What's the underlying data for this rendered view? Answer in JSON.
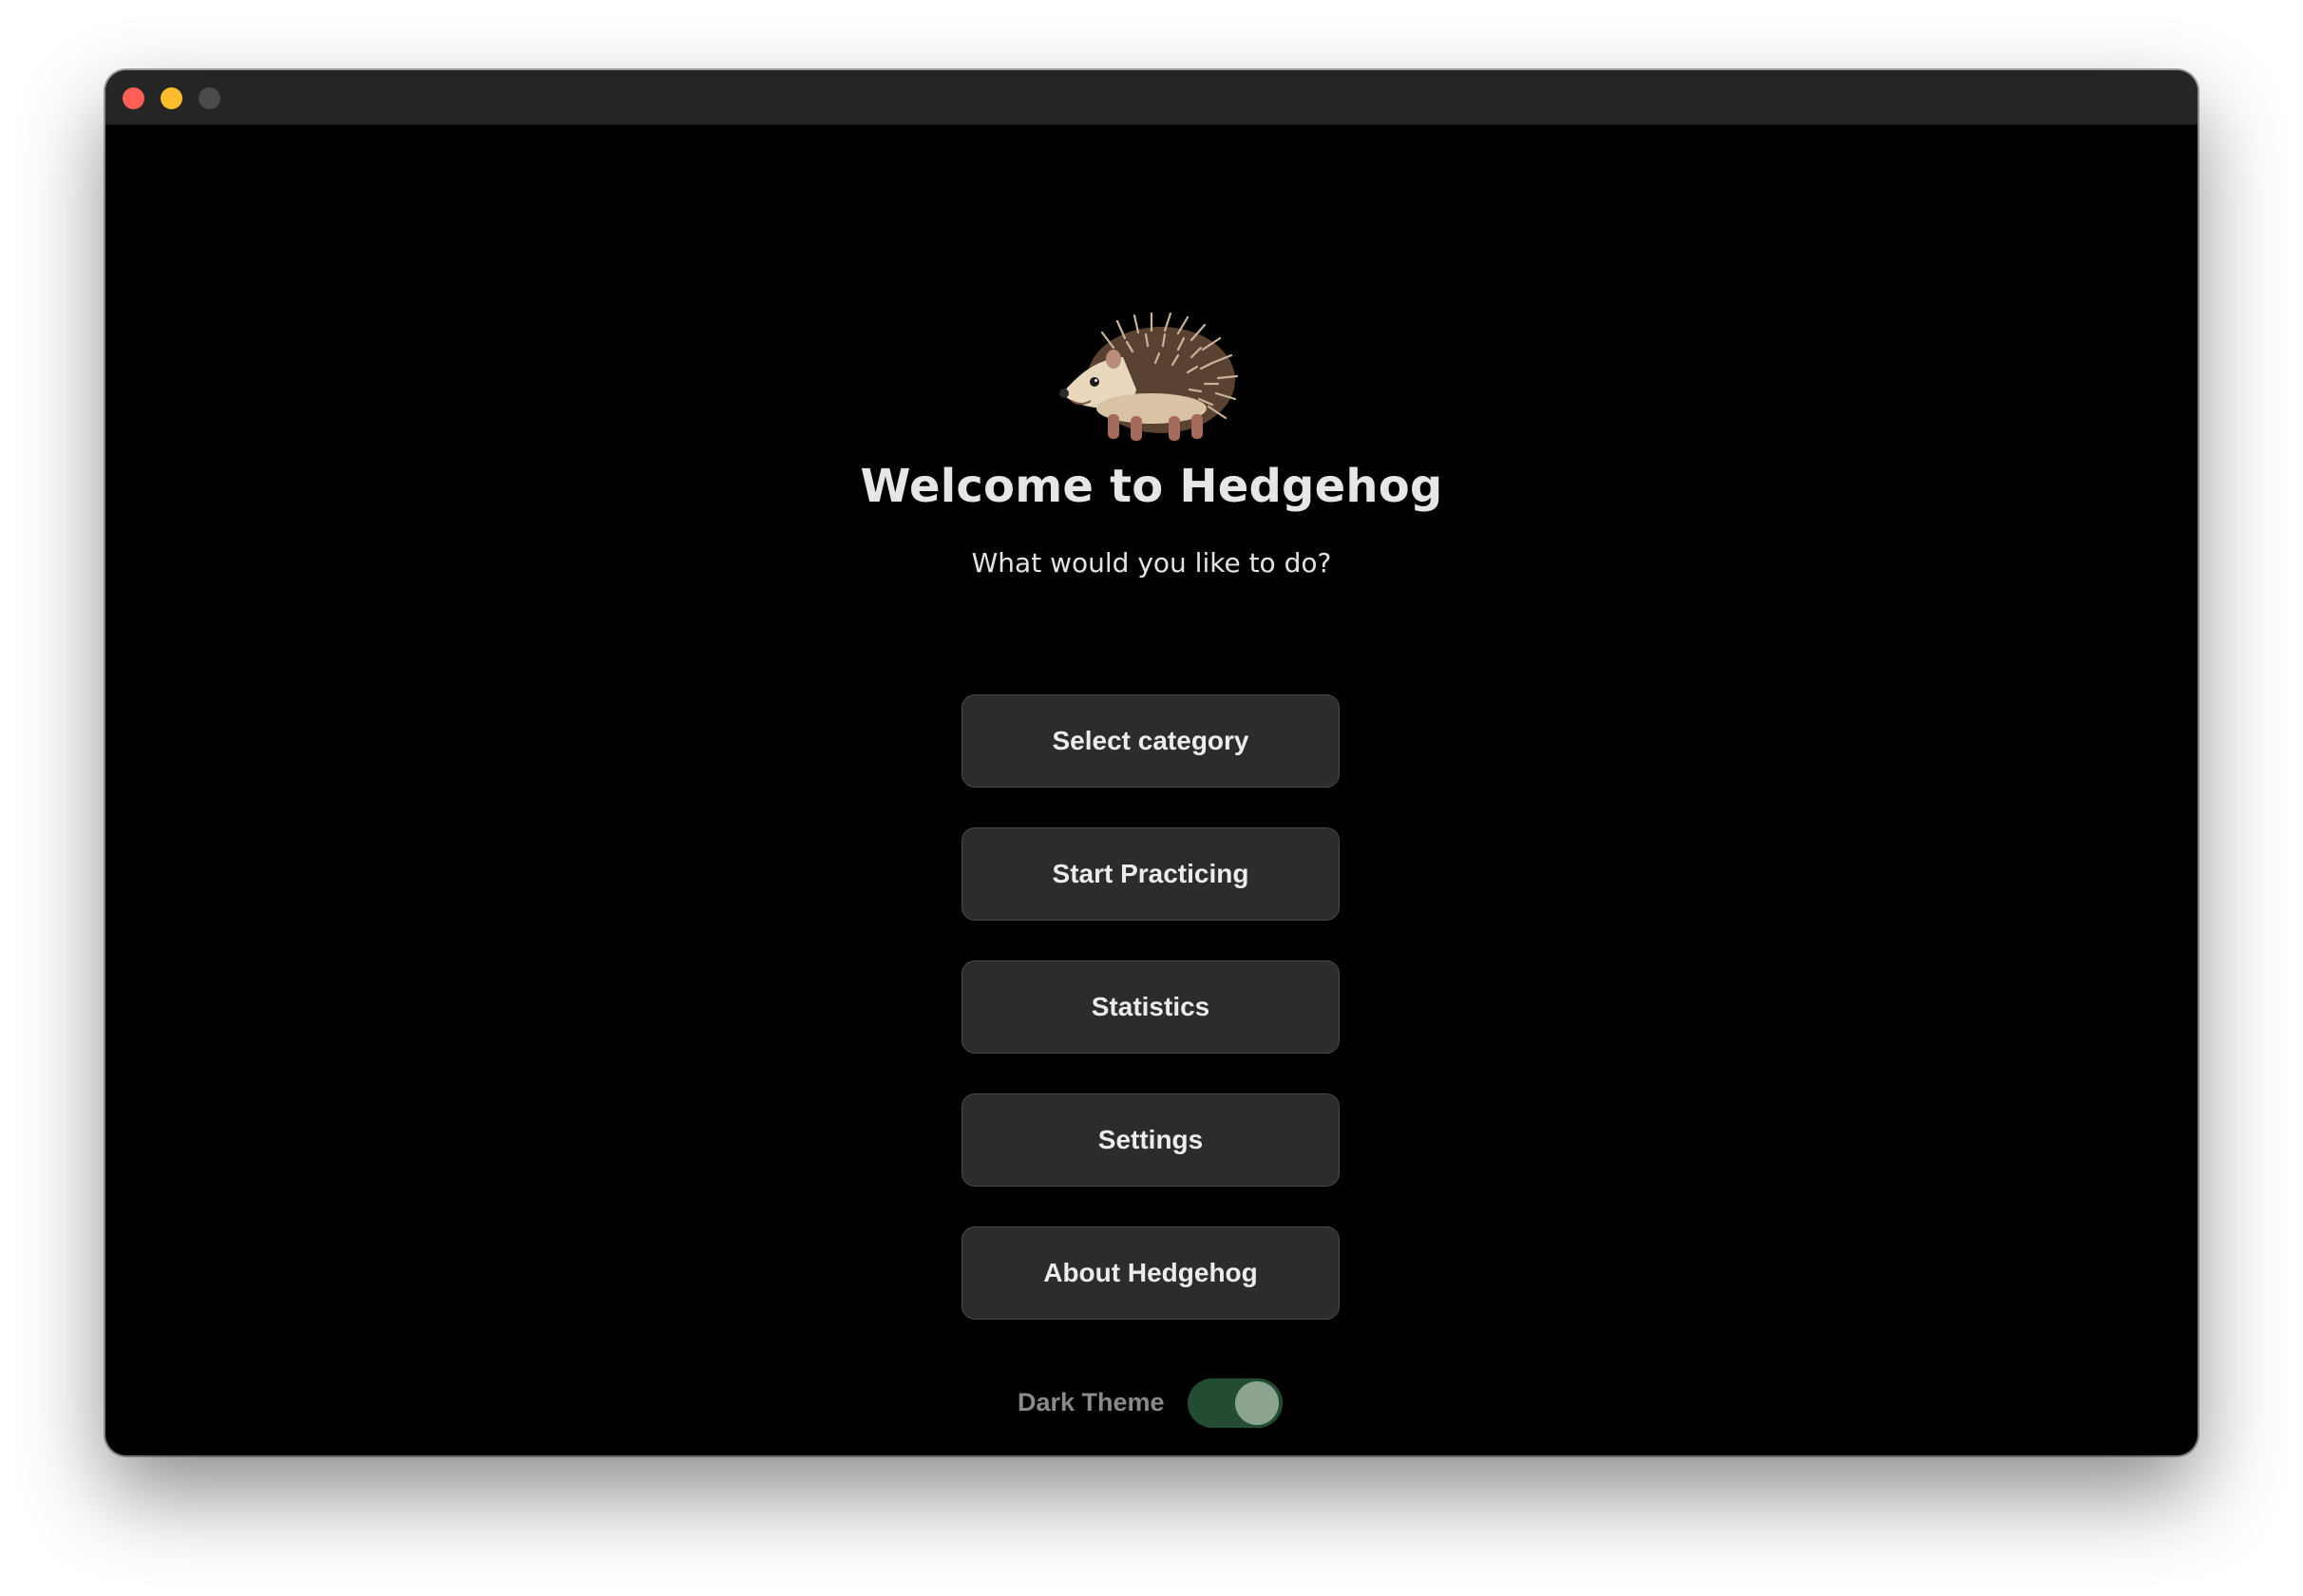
{
  "window": {
    "controls": [
      "close",
      "minimize",
      "zoom"
    ]
  },
  "mascot": {
    "icon": "hedgehog-icon"
  },
  "welcome": {
    "title": "Welcome to Hedgehog",
    "subtitle": "What would you like to do?"
  },
  "menu": {
    "buttons": [
      {
        "label": "Select category"
      },
      {
        "label": "Start Practicing"
      },
      {
        "label": "Statistics"
      },
      {
        "label": "Settings"
      },
      {
        "label": "About Hedgehog"
      }
    ]
  },
  "theme": {
    "label": "Dark Theme",
    "dark_enabled": true
  },
  "colors": {
    "window_bg": "#000000",
    "titlebar_bg": "#252525",
    "button_bg": "#2c2c2c",
    "toggle_track": "#234d33",
    "toggle_knob": "#8ca48f",
    "close": "#ff5f57",
    "minimize": "#febc2e",
    "zoom_inactive": "#4b4b4b"
  }
}
